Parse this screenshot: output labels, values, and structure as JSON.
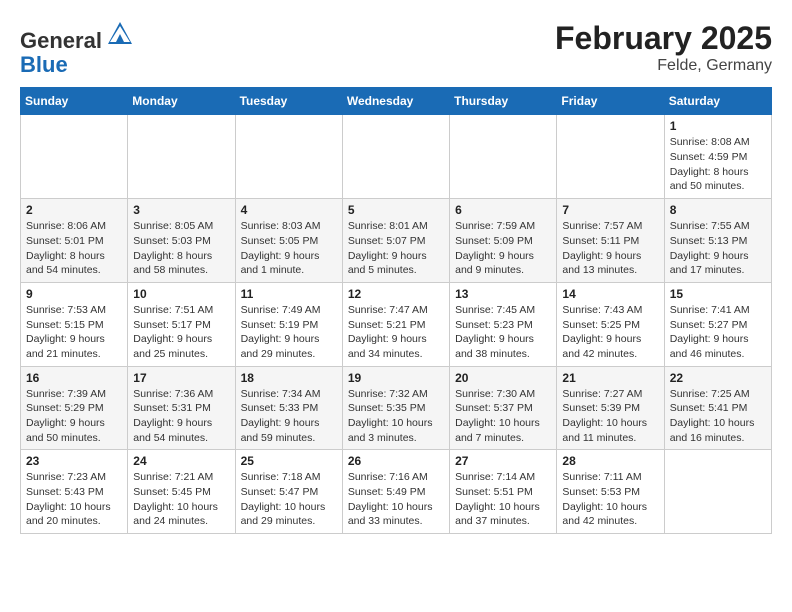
{
  "logo": {
    "general": "General",
    "blue": "Blue"
  },
  "title": "February 2025",
  "subtitle": "Felde, Germany",
  "days_of_week": [
    "Sunday",
    "Monday",
    "Tuesday",
    "Wednesday",
    "Thursday",
    "Friday",
    "Saturday"
  ],
  "weeks": [
    [
      {
        "day": "",
        "info": ""
      },
      {
        "day": "",
        "info": ""
      },
      {
        "day": "",
        "info": ""
      },
      {
        "day": "",
        "info": ""
      },
      {
        "day": "",
        "info": ""
      },
      {
        "day": "",
        "info": ""
      },
      {
        "day": "1",
        "info": "Sunrise: 8:08 AM\nSunset: 4:59 PM\nDaylight: 8 hours and 50 minutes."
      }
    ],
    [
      {
        "day": "2",
        "info": "Sunrise: 8:06 AM\nSunset: 5:01 PM\nDaylight: 8 hours and 54 minutes."
      },
      {
        "day": "3",
        "info": "Sunrise: 8:05 AM\nSunset: 5:03 PM\nDaylight: 8 hours and 58 minutes."
      },
      {
        "day": "4",
        "info": "Sunrise: 8:03 AM\nSunset: 5:05 PM\nDaylight: 9 hours and 1 minute."
      },
      {
        "day": "5",
        "info": "Sunrise: 8:01 AM\nSunset: 5:07 PM\nDaylight: 9 hours and 5 minutes."
      },
      {
        "day": "6",
        "info": "Sunrise: 7:59 AM\nSunset: 5:09 PM\nDaylight: 9 hours and 9 minutes."
      },
      {
        "day": "7",
        "info": "Sunrise: 7:57 AM\nSunset: 5:11 PM\nDaylight: 9 hours and 13 minutes."
      },
      {
        "day": "8",
        "info": "Sunrise: 7:55 AM\nSunset: 5:13 PM\nDaylight: 9 hours and 17 minutes."
      }
    ],
    [
      {
        "day": "9",
        "info": "Sunrise: 7:53 AM\nSunset: 5:15 PM\nDaylight: 9 hours and 21 minutes."
      },
      {
        "day": "10",
        "info": "Sunrise: 7:51 AM\nSunset: 5:17 PM\nDaylight: 9 hours and 25 minutes."
      },
      {
        "day": "11",
        "info": "Sunrise: 7:49 AM\nSunset: 5:19 PM\nDaylight: 9 hours and 29 minutes."
      },
      {
        "day": "12",
        "info": "Sunrise: 7:47 AM\nSunset: 5:21 PM\nDaylight: 9 hours and 34 minutes."
      },
      {
        "day": "13",
        "info": "Sunrise: 7:45 AM\nSunset: 5:23 PM\nDaylight: 9 hours and 38 minutes."
      },
      {
        "day": "14",
        "info": "Sunrise: 7:43 AM\nSunset: 5:25 PM\nDaylight: 9 hours and 42 minutes."
      },
      {
        "day": "15",
        "info": "Sunrise: 7:41 AM\nSunset: 5:27 PM\nDaylight: 9 hours and 46 minutes."
      }
    ],
    [
      {
        "day": "16",
        "info": "Sunrise: 7:39 AM\nSunset: 5:29 PM\nDaylight: 9 hours and 50 minutes."
      },
      {
        "day": "17",
        "info": "Sunrise: 7:36 AM\nSunset: 5:31 PM\nDaylight: 9 hours and 54 minutes."
      },
      {
        "day": "18",
        "info": "Sunrise: 7:34 AM\nSunset: 5:33 PM\nDaylight: 9 hours and 59 minutes."
      },
      {
        "day": "19",
        "info": "Sunrise: 7:32 AM\nSunset: 5:35 PM\nDaylight: 10 hours and 3 minutes."
      },
      {
        "day": "20",
        "info": "Sunrise: 7:30 AM\nSunset: 5:37 PM\nDaylight: 10 hours and 7 minutes."
      },
      {
        "day": "21",
        "info": "Sunrise: 7:27 AM\nSunset: 5:39 PM\nDaylight: 10 hours and 11 minutes."
      },
      {
        "day": "22",
        "info": "Sunrise: 7:25 AM\nSunset: 5:41 PM\nDaylight: 10 hours and 16 minutes."
      }
    ],
    [
      {
        "day": "23",
        "info": "Sunrise: 7:23 AM\nSunset: 5:43 PM\nDaylight: 10 hours and 20 minutes."
      },
      {
        "day": "24",
        "info": "Sunrise: 7:21 AM\nSunset: 5:45 PM\nDaylight: 10 hours and 24 minutes."
      },
      {
        "day": "25",
        "info": "Sunrise: 7:18 AM\nSunset: 5:47 PM\nDaylight: 10 hours and 29 minutes."
      },
      {
        "day": "26",
        "info": "Sunrise: 7:16 AM\nSunset: 5:49 PM\nDaylight: 10 hours and 33 minutes."
      },
      {
        "day": "27",
        "info": "Sunrise: 7:14 AM\nSunset: 5:51 PM\nDaylight: 10 hours and 37 minutes."
      },
      {
        "day": "28",
        "info": "Sunrise: 7:11 AM\nSunset: 5:53 PM\nDaylight: 10 hours and 42 minutes."
      },
      {
        "day": "",
        "info": ""
      }
    ]
  ]
}
